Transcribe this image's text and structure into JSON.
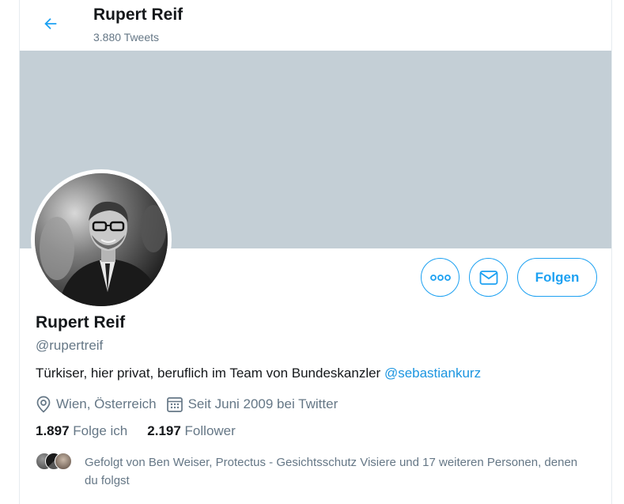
{
  "header": {
    "title": "Rupert Reif",
    "tweets_count": "3.880 Tweets"
  },
  "profile": {
    "name": "Rupert Reif",
    "handle": "@rupertreif",
    "bio_text": "Türkiser, hier privat, beruflich im Team von Bundeskanzler ",
    "bio_mention": "@sebastiankurz",
    "location": "Wien, Österreich",
    "joined": "Seit Juni 2009 bei Twitter"
  },
  "stats": {
    "following_count": "1.897",
    "following_label": "Folge ich",
    "followers_count": "2.197",
    "followers_label": "Follower"
  },
  "actions": {
    "follow_label": "Folgen"
  },
  "followed_by": {
    "text": "Gefolgt von Ben Weiser, Protectus - Gesichtsschutz Visiere und 17 weiteren Personen, denen du folgst"
  },
  "icons": {
    "back": "arrow-left-icon",
    "more": "more-dots-icon",
    "message": "envelope-icon",
    "location": "location-pin-icon",
    "calendar": "calendar-icon"
  },
  "colors": {
    "accent": "#1da1f2",
    "banner": "#c4cfd6",
    "secondary_text": "#657786",
    "primary_text": "#14171a"
  }
}
